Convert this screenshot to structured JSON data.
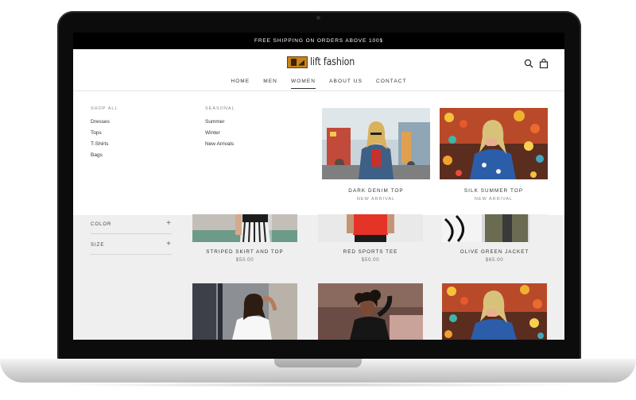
{
  "announcement": "FREE SHIPPING ON ORDERS ABOVE 100$",
  "brand": {
    "name": "lift fashion",
    "logo_icon": "shoe-logo-icon"
  },
  "nav": {
    "items": [
      "HOME",
      "MEN",
      "WOMEN",
      "ABOUT US",
      "CONTACT"
    ],
    "active": "WOMEN"
  },
  "header_icons": [
    "search-icon",
    "shopping-bag-icon"
  ],
  "mega_menu": {
    "shop_all": {
      "title": "SHOP ALL",
      "items": [
        "Dresses",
        "Tops",
        "T-Shirts",
        "Bags"
      ]
    },
    "seasonal": {
      "title": "SEASONAL",
      "items": [
        "Summer",
        "Winter",
        "New Arrivals"
      ]
    },
    "promos": [
      {
        "title": "DARK DENIM TOP",
        "subtitle": "NEW ARRIVAL"
      },
      {
        "title": "SILK SUMMER TOP",
        "subtitle": "NEW ARRIVAL"
      }
    ]
  },
  "filters": [
    {
      "label": "COLOR",
      "icon": "plus-icon"
    },
    {
      "label": "SIZE",
      "icon": "plus-icon"
    }
  ],
  "products": [
    {
      "name": "STRIPED SKIRT AND TOP",
      "price": "$50.00"
    },
    {
      "name": "RED SPORTS TEE",
      "price": "$50.00"
    },
    {
      "name": "OLIVE GREEN JACKET",
      "price": "$65.00"
    }
  ],
  "colors": {
    "announcement_bg": "#000000",
    "screen_bg": "#efefef",
    "logo_accent": "#c8841a"
  }
}
